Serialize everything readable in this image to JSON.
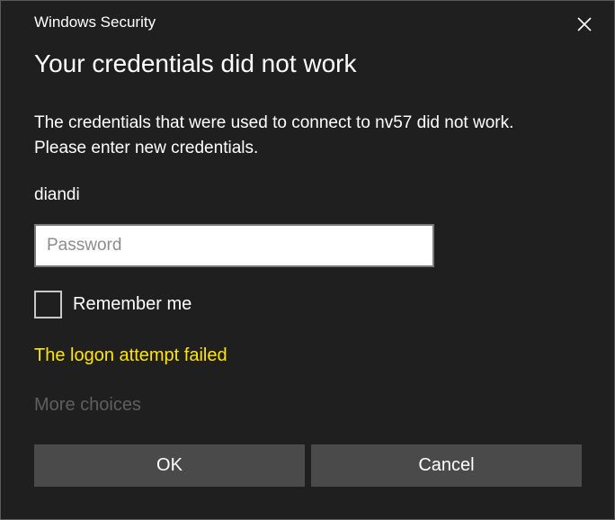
{
  "window": {
    "title": "Windows Security"
  },
  "dialog": {
    "heading": "Your credentials did not work",
    "message_line1": "The credentials that were used to connect to nv57 did not work.",
    "message_line2": "Please enter new credentials.",
    "username": "diandi",
    "password_placeholder": "Password",
    "password_value": "",
    "remember_label": "Remember me",
    "remember_checked": false,
    "error_text": "The logon attempt failed",
    "more_choices_label": "More choices"
  },
  "buttons": {
    "ok_label": "OK",
    "cancel_label": "Cancel"
  },
  "icons": {
    "close": "close-icon"
  },
  "colors": {
    "background": "#1f1f1f",
    "error": "#ffe600",
    "button": "#4a4a4a",
    "disabled_text": "#5f5f5f"
  }
}
